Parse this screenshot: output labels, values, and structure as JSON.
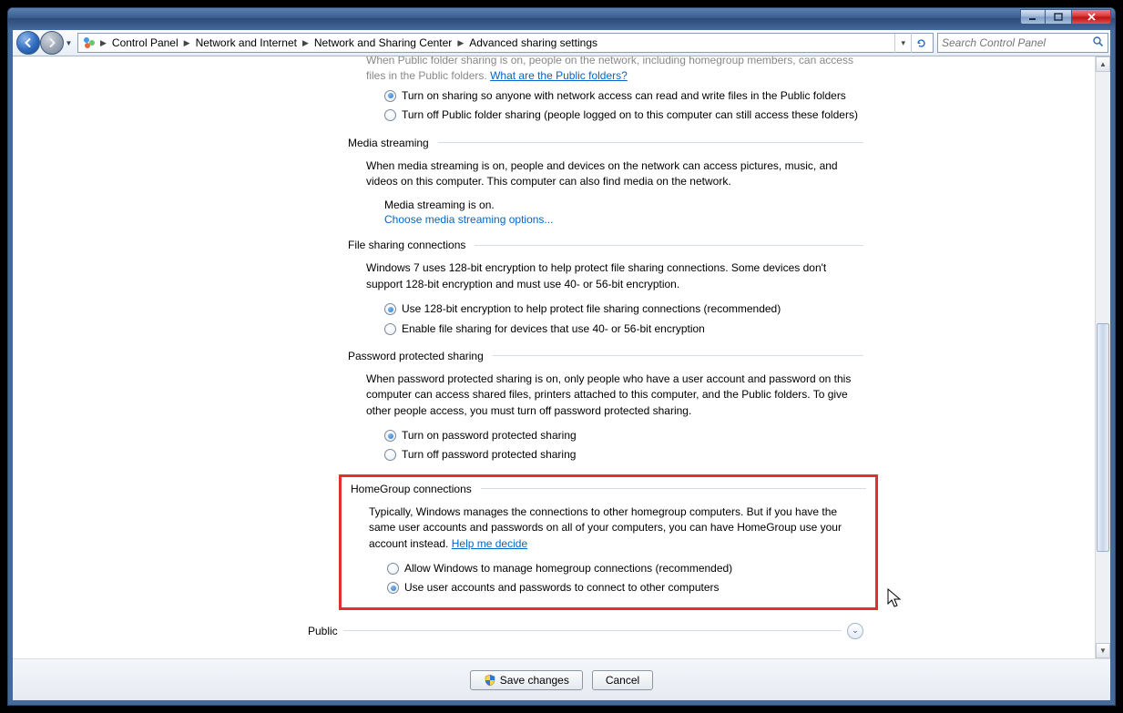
{
  "titlebar": {
    "min": "",
    "max": "",
    "close": ""
  },
  "breadcrumbs": [
    "Control Panel",
    "Network and Internet",
    "Network and Sharing Center",
    "Advanced sharing settings"
  ],
  "search": {
    "placeholder": "Search Control Panel"
  },
  "partial": {
    "desc_tail": "When Public folder sharing is on, people on the network, including homegroup members, can access files in the Public folders. ",
    "link": "What are the Public folders?",
    "opt1": "Turn on sharing so anyone with network access can read and write files in the Public folders",
    "opt2": "Turn off Public folder sharing (people logged on to this computer can still access these folders)"
  },
  "media": {
    "title": "Media streaming",
    "desc": "When media streaming is on, people and devices on the network can access pictures, music, and videos on this computer. This computer can also find media on the network.",
    "status": "Media streaming is on.",
    "link": "Choose media streaming options..."
  },
  "filesharing": {
    "title": "File sharing connections",
    "desc": "Windows 7 uses 128-bit encryption to help protect file sharing connections. Some devices don't support 128-bit encryption and must use 40- or 56-bit encryption.",
    "opt1": "Use 128-bit encryption to help protect file sharing connections (recommended)",
    "opt2": "Enable file sharing for devices that use 40- or 56-bit encryption"
  },
  "password": {
    "title": "Password protected sharing",
    "desc": "When password protected sharing is on, only people who have a user account and password on this computer can access shared files, printers attached to this computer, and the Public folders. To give other people access, you must turn off password protected sharing.",
    "opt1": "Turn on password protected sharing",
    "opt2": "Turn off password protected sharing"
  },
  "homegroup": {
    "title": "HomeGroup connections",
    "desc": "Typically, Windows manages the connections to other homegroup computers. But if you have the same user accounts and passwords on all of your computers, you can have HomeGroup use your account instead. ",
    "link": "Help me decide",
    "opt1": "Allow Windows to manage homegroup connections (recommended)",
    "opt2": "Use user accounts and passwords to connect to other computers"
  },
  "profile": {
    "label": "Public"
  },
  "footer": {
    "save": "Save changes",
    "cancel": "Cancel"
  }
}
